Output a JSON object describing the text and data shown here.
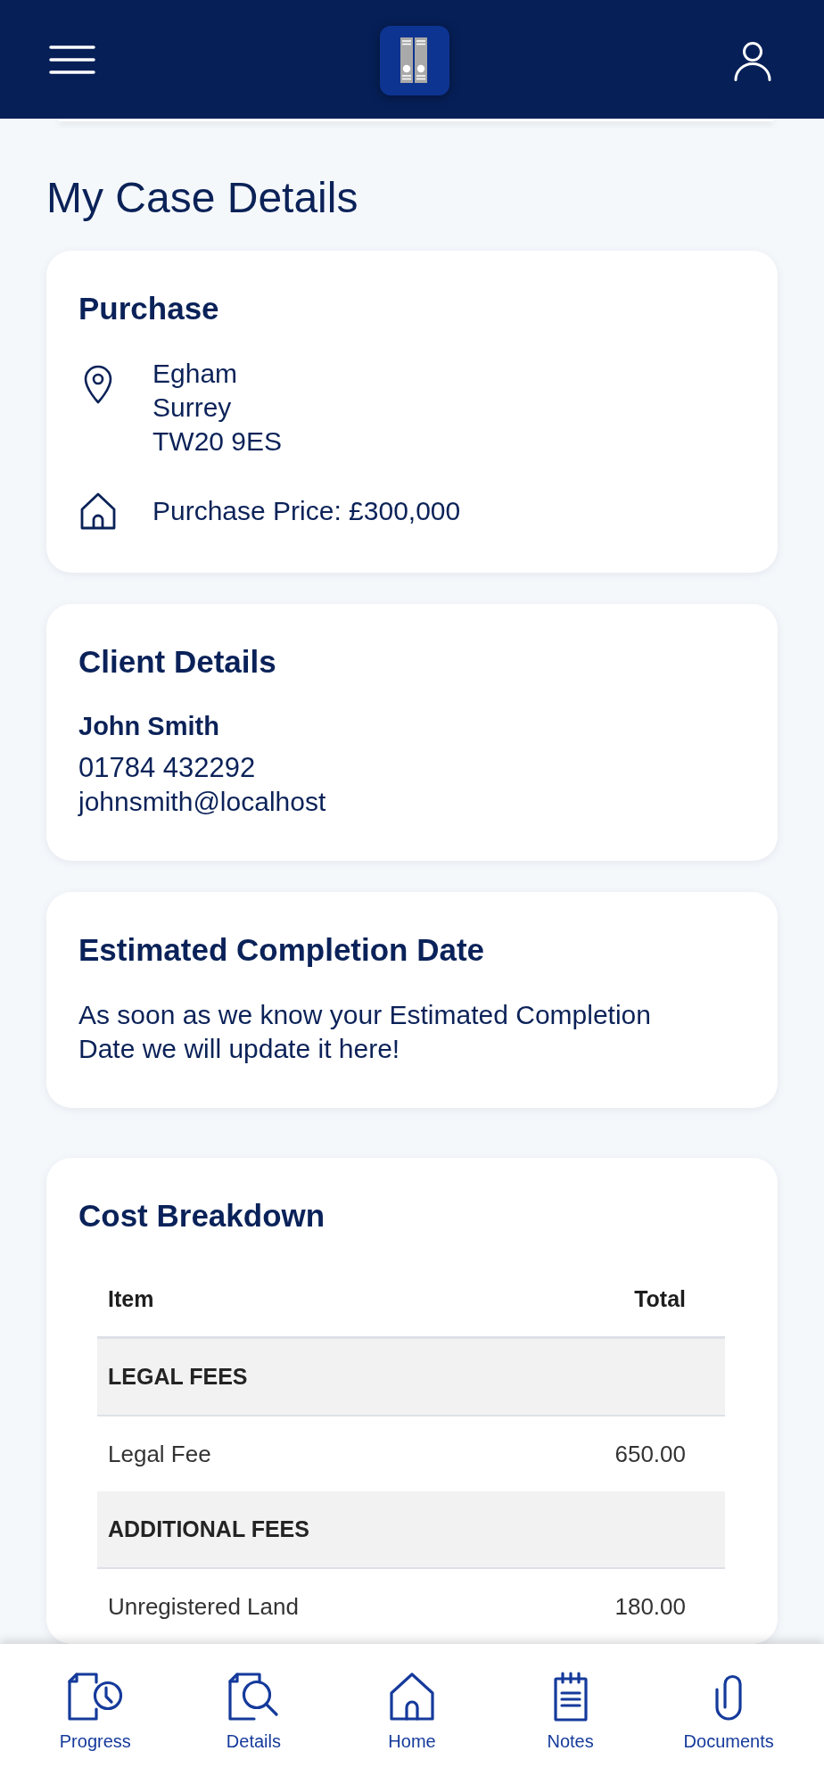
{
  "page_title": "My Case Details",
  "purchase": {
    "title": "Purchase",
    "address_lines": [
      "Egham",
      "Surrey",
      "TW20 9ES"
    ],
    "price": "Purchase Price: £300,000"
  },
  "client_details": {
    "title": "Client Details",
    "name": "John Smith",
    "phone": "01784 432292",
    "email": "johnsmith@localhost"
  },
  "completion": {
    "title": "Estimated Completion Date",
    "message": "As soon as we know your Estimated Completion Date we will update it here!"
  },
  "cost_breakdown": {
    "title": "Cost Breakdown",
    "columns": [
      "Item",
      "Total"
    ],
    "rows": [
      {
        "kind": "group",
        "item": "LEGAL FEES"
      },
      {
        "kind": "fee",
        "item": "Legal Fee",
        "total": "650.00"
      },
      {
        "kind": "group",
        "item": "ADDITIONAL FEES"
      },
      {
        "kind": "fee",
        "item": "Unregistered Land",
        "total": "180.00"
      }
    ]
  },
  "bottom_nav": [
    "Progress",
    "Details",
    "Home",
    "Notes",
    "Documents"
  ]
}
